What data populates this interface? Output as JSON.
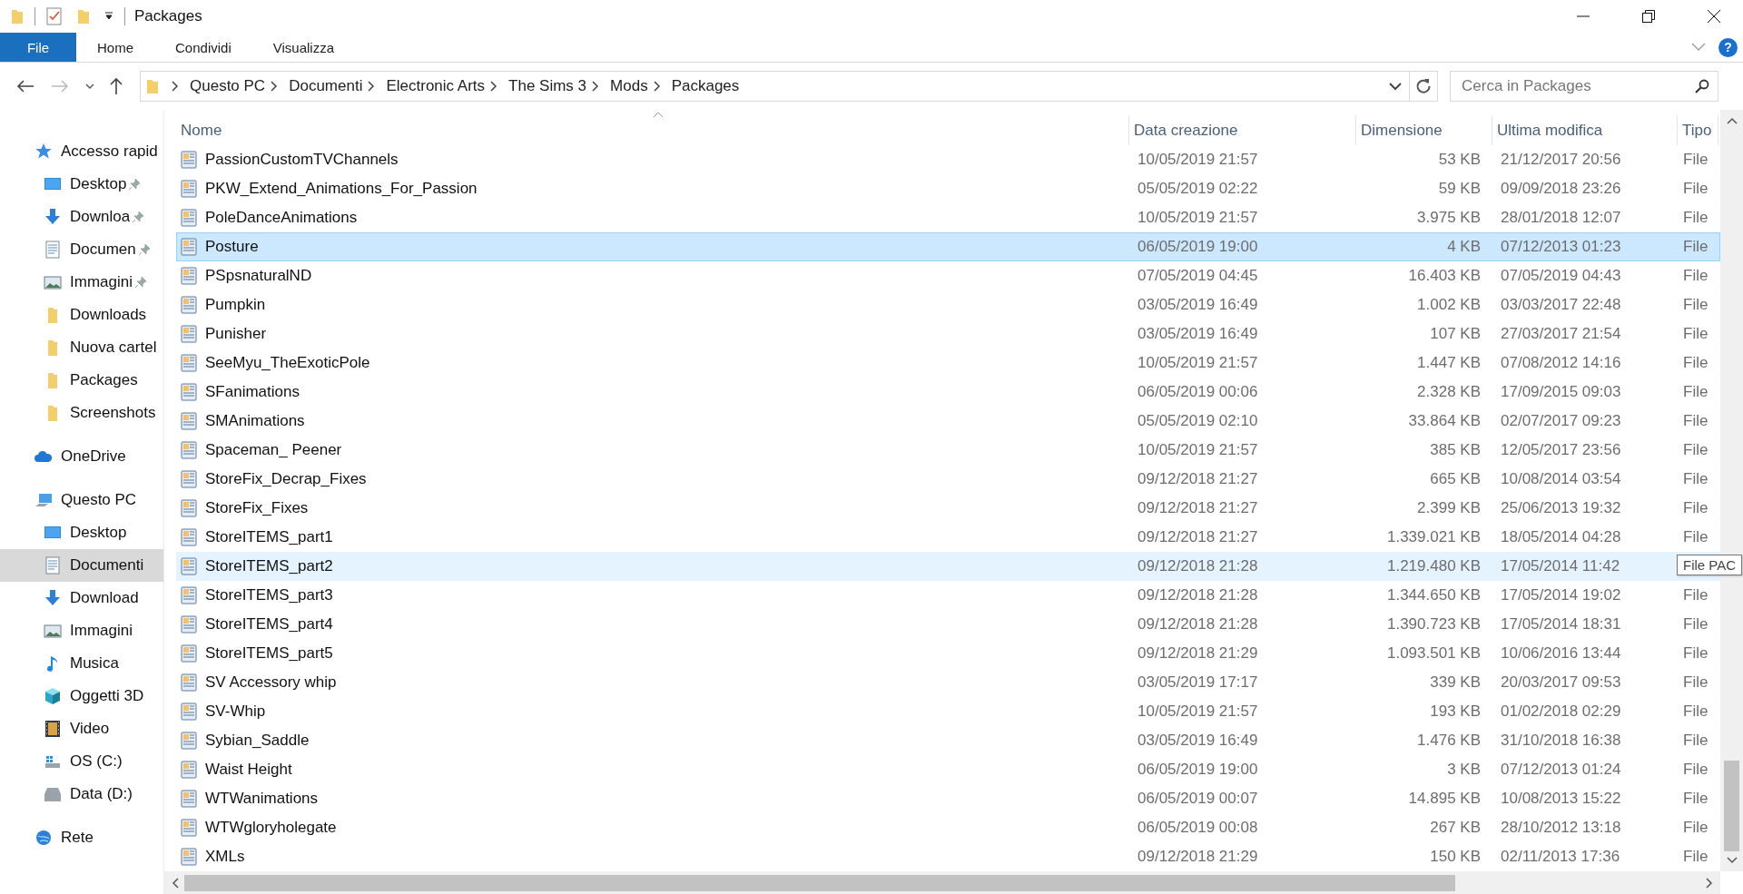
{
  "window": {
    "title": "Packages"
  },
  "ribbon": {
    "file_button": "File",
    "tabs": [
      "Home",
      "Condividi",
      "Visualizza"
    ],
    "help_button": "?"
  },
  "address": {
    "breadcrumbs": [
      "Questo PC",
      "Documenti",
      "Electronic Arts",
      "The Sims 3",
      "Mods",
      "Packages"
    ]
  },
  "search": {
    "placeholder": "Cerca in Packages"
  },
  "sidebar": {
    "items": [
      {
        "label": "Accesso rapid",
        "kind": "star",
        "selected": false,
        "children": [
          {
            "label": "Desktop",
            "kind": "desktop",
            "pinned": true,
            "selected": false
          },
          {
            "label": "Downloa",
            "kind": "download",
            "pinned": true,
            "selected": false
          },
          {
            "label": "Documen",
            "kind": "document",
            "pinned": true,
            "selected": false
          },
          {
            "label": "Immagini",
            "kind": "image",
            "pinned": true,
            "selected": false
          },
          {
            "label": "Downloads",
            "kind": "folder",
            "pinned": false,
            "selected": false
          },
          {
            "label": "Nuova cartel",
            "kind": "folder",
            "pinned": false,
            "selected": false
          },
          {
            "label": "Packages",
            "kind": "folder",
            "pinned": false,
            "selected": false
          },
          {
            "label": "Screenshots",
            "kind": "folder",
            "pinned": false,
            "selected": false
          }
        ]
      },
      {
        "label": "OneDrive",
        "kind": "cloud",
        "selected": false
      },
      {
        "label": "Questo PC",
        "kind": "pc",
        "selected": false,
        "children": [
          {
            "label": "Desktop",
            "kind": "desktop",
            "selected": false
          },
          {
            "label": "Documenti",
            "kind": "document",
            "selected": true
          },
          {
            "label": "Download",
            "kind": "download",
            "selected": false
          },
          {
            "label": "Immagini",
            "kind": "image",
            "selected": false
          },
          {
            "label": "Musica",
            "kind": "music",
            "selected": false
          },
          {
            "label": "Oggetti 3D",
            "kind": "cube",
            "selected": false
          },
          {
            "label": "Video",
            "kind": "film",
            "selected": false
          },
          {
            "label": "OS (C:)",
            "kind": "system-drive",
            "selected": false
          },
          {
            "label": "Data (D:)",
            "kind": "drive",
            "selected": false
          }
        ]
      },
      {
        "label": "Rete",
        "kind": "network",
        "selected": false
      }
    ]
  },
  "table": {
    "columns": [
      "Nome",
      "Data creazione",
      "Dimensione",
      "Ultima modifica",
      "Tipo"
    ],
    "rows": [
      {
        "name": "PassionCustomTVChannels",
        "created": "10/05/2019 21:57",
        "size": "53 KB",
        "modified": "21/12/2017 20:56",
        "type": "File",
        "selected": false,
        "hovered": false
      },
      {
        "name": "PKW_Extend_Animations_For_Passion",
        "created": "05/05/2019 02:22",
        "size": "59 KB",
        "modified": "09/09/2018 23:26",
        "type": "File",
        "selected": false,
        "hovered": false
      },
      {
        "name": "PoleDanceAnimations",
        "created": "10/05/2019 21:57",
        "size": "3.975 KB",
        "modified": "28/01/2018 12:07",
        "type": "File",
        "selected": false,
        "hovered": false
      },
      {
        "name": "Posture",
        "created": "06/05/2019 19:00",
        "size": "4 KB",
        "modified": "07/12/2013 01:23",
        "type": "File",
        "selected": true,
        "hovered": false
      },
      {
        "name": "PSpsnaturalND",
        "created": "07/05/2019 04:45",
        "size": "16.403 KB",
        "modified": "07/05/2019 04:43",
        "type": "File",
        "selected": false,
        "hovered": false
      },
      {
        "name": "Pumpkin",
        "created": "03/05/2019 16:49",
        "size": "1.002 KB",
        "modified": "03/03/2017 22:48",
        "type": "File",
        "selected": false,
        "hovered": false
      },
      {
        "name": "Punisher",
        "created": "03/05/2019 16:49",
        "size": "107 KB",
        "modified": "27/03/2017 21:54",
        "type": "File",
        "selected": false,
        "hovered": false
      },
      {
        "name": "SeeMyu_TheExoticPole",
        "created": "10/05/2019 21:57",
        "size": "1.447 KB",
        "modified": "07/08/2012 14:16",
        "type": "File",
        "selected": false,
        "hovered": false
      },
      {
        "name": "SFanimations",
        "created": "06/05/2019 00:06",
        "size": "2.328 KB",
        "modified": "17/09/2015 09:03",
        "type": "File",
        "selected": false,
        "hovered": false
      },
      {
        "name": "SMAnimations",
        "created": "05/05/2019 02:10",
        "size": "33.864 KB",
        "modified": "02/07/2017 09:23",
        "type": "File",
        "selected": false,
        "hovered": false
      },
      {
        "name": "Spaceman_ Peener",
        "created": "10/05/2019 21:57",
        "size": "385 KB",
        "modified": "12/05/2017 23:56",
        "type": "File",
        "selected": false,
        "hovered": false
      },
      {
        "name": "StoreFix_Decrap_Fixes",
        "created": "09/12/2018 21:27",
        "size": "665 KB",
        "modified": "10/08/2014 03:54",
        "type": "File",
        "selected": false,
        "hovered": false
      },
      {
        "name": "StoreFix_Fixes",
        "created": "09/12/2018 21:27",
        "size": "2.399 KB",
        "modified": "25/06/2013 19:32",
        "type": "File",
        "selected": false,
        "hovered": false
      },
      {
        "name": "StoreITEMS_part1",
        "created": "09/12/2018 21:27",
        "size": "1.339.021 KB",
        "modified": "18/05/2014 04:28",
        "type": "File",
        "selected": false,
        "hovered": false
      },
      {
        "name": "StoreITEMS_part2",
        "created": "09/12/2018 21:28",
        "size": "1.219.480 KB",
        "modified": "17/05/2014 11:42",
        "tooltip": "File PAC",
        "selected": false,
        "hovered": true
      },
      {
        "name": "StoreITEMS_part3",
        "created": "09/12/2018 21:28",
        "size": "1.344.650 KB",
        "modified": "17/05/2014 19:02",
        "type": "File",
        "selected": false,
        "hovered": false
      },
      {
        "name": "StoreITEMS_part4",
        "created": "09/12/2018 21:28",
        "size": "1.390.723 KB",
        "modified": "17/05/2014 18:31",
        "type": "File",
        "selected": false,
        "hovered": false
      },
      {
        "name": "StoreITEMS_part5",
        "created": "09/12/2018 21:29",
        "size": "1.093.501 KB",
        "modified": "10/06/2016 13:44",
        "type": "File",
        "selected": false,
        "hovered": false
      },
      {
        "name": "SV Accessory whip",
        "created": "03/05/2019 17:17",
        "size": "339 KB",
        "modified": "20/03/2017 09:53",
        "type": "File",
        "selected": false,
        "hovered": false
      },
      {
        "name": "SV-Whip",
        "created": "10/05/2019 21:57",
        "size": "193 KB",
        "modified": "01/02/2018 02:29",
        "type": "File",
        "selected": false,
        "hovered": false
      },
      {
        "name": "Sybian_Saddle",
        "created": "03/05/2019 16:49",
        "size": "1.476 KB",
        "modified": "31/10/2018 16:38",
        "type": "File",
        "selected": false,
        "hovered": false
      },
      {
        "name": "Waist Height",
        "created": "06/05/2019 19:00",
        "size": "3 KB",
        "modified": "07/12/2013 01:24",
        "type": "File",
        "selected": false,
        "hovered": false
      },
      {
        "name": "WTWanimations",
        "created": "06/05/2019 00:07",
        "size": "14.895 KB",
        "modified": "10/08/2013 15:22",
        "type": "File",
        "selected": false,
        "hovered": false
      },
      {
        "name": "WTWgloryholegate",
        "created": "06/05/2019 00:08",
        "size": "267 KB",
        "modified": "28/10/2012 13:18",
        "type": "File",
        "selected": false,
        "hovered": false
      },
      {
        "name": "XMLs",
        "created": "09/12/2018 21:29",
        "size": "150 KB",
        "modified": "02/11/2013 17:36",
        "type": "File",
        "selected": false,
        "hovered": false
      }
    ]
  }
}
